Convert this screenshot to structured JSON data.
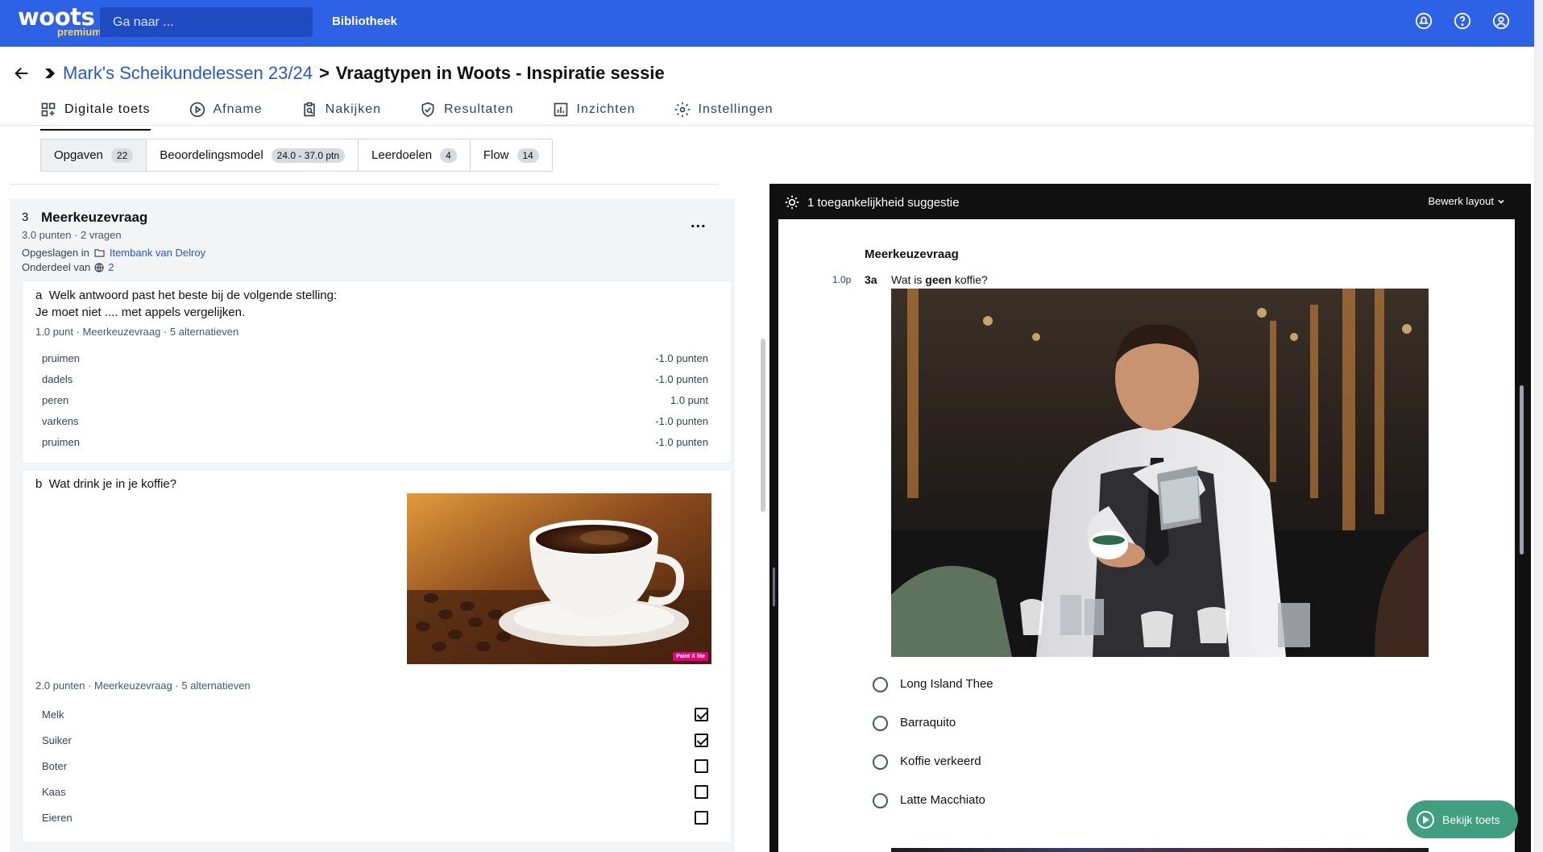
{
  "app": {
    "logo_text": "woots",
    "logo_sub": "premium",
    "search_placeholder": "Ga naar ...",
    "nav_library": "Bibliotheek"
  },
  "breadcrumb": {
    "parent": "Mark's Scheikundelessen 23/24",
    "separator": ">",
    "current": "Vraagtypen in Woots - Inspiratie sessie"
  },
  "tabs": [
    {
      "label": "Digitale toets",
      "icon": "grid-plus-icon",
      "active": true
    },
    {
      "label": "Afname",
      "icon": "play-circle-icon"
    },
    {
      "label": "Nakijken",
      "icon": "clipboard-search-icon"
    },
    {
      "label": "Resultaten",
      "icon": "shield-check-icon"
    },
    {
      "label": "Inzichten",
      "icon": "bar-chart-icon"
    },
    {
      "label": "Instellingen",
      "icon": "gear-icon"
    }
  ],
  "subtabs": [
    {
      "label": "Opgaven",
      "badge": "22",
      "active": true
    },
    {
      "label": "Beoordelingsmodel",
      "badge": "24.0 - 37.0 ptn"
    },
    {
      "label": "Leerdoelen",
      "badge": "4"
    },
    {
      "label": "Flow",
      "badge": "14"
    }
  ],
  "question": {
    "number": "3",
    "title": "Meerkeuzevraag",
    "meta": "3.0 punten · 2 vragen",
    "saved_label": "Opgeslagen in",
    "saved_folder": "Itembank van Delroy",
    "part_label": "Onderdeel van",
    "part_count": "2",
    "more": "..."
  },
  "sub_a": {
    "letter": "a",
    "text_line1": "Welk antwoord past het beste bij de volgende stelling:",
    "text_line2": "Je moet niet  .... met appels vergelijken.",
    "meta": "1.0 punt · Meerkeuzevraag · 5 alternatieven",
    "options": [
      {
        "label": "pruimen",
        "points": "-1.0 punten"
      },
      {
        "label": "dadels",
        "points": "-1.0 punten"
      },
      {
        "label": "peren",
        "points": "1.0 punt"
      },
      {
        "label": "varkens",
        "points": "-1.0 punten"
      },
      {
        "label": "pruimen",
        "points": "-1.0 punten"
      }
    ]
  },
  "sub_b": {
    "letter": "b",
    "text": "Wat drink je in je koffie?",
    "image_tag": "Paint X lite",
    "meta": "2.0 punten · Meerkeuzevraag · 5 alternatieven",
    "options": [
      {
        "label": "Melk",
        "checked": true
      },
      {
        "label": "Suiker",
        "checked": true
      },
      {
        "label": "Boter",
        "checked": false
      },
      {
        "label": "Kaas",
        "checked": false
      },
      {
        "label": "Eieren",
        "checked": false
      }
    ]
  },
  "preview": {
    "suggestion": "1 toegankelijkheid suggestie",
    "layout_button": "Bewerk layout",
    "title": "Meerkeuzevraag",
    "points": "1.0p",
    "number": "3a",
    "question_pre": "Wat is ",
    "question_bold": "geen",
    "question_post": " koffie?",
    "options": [
      "Long Island Thee",
      "Barraquito",
      "Koffie verkeerd",
      "Latte Macchiato"
    ]
  },
  "cta": {
    "label": "Bekijk toets"
  },
  "colors": {
    "brand": "#2e62e6",
    "accent_green": "#3f9f7e",
    "link": "#2456d8"
  }
}
